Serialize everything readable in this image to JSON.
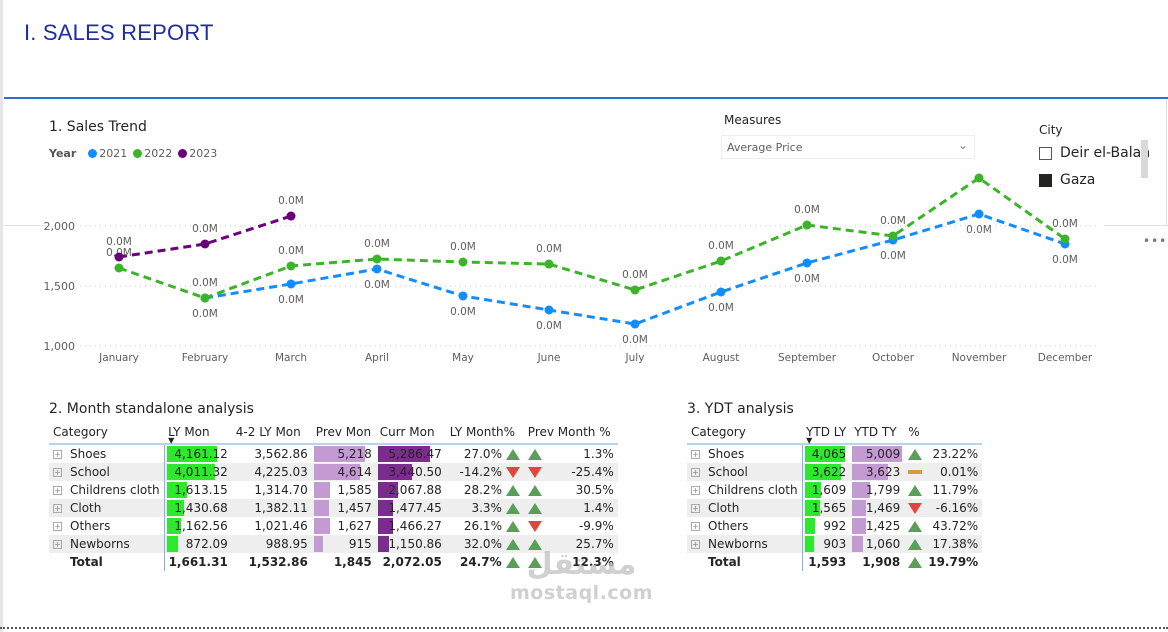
{
  "page": {
    "title": "I. SALES REPORT"
  },
  "sales_trend": {
    "title": "1. Sales Trend",
    "legend_title": "Year",
    "more_icon": "more-options-icon"
  },
  "measures": {
    "label": "Measures",
    "selected": "Average Price"
  },
  "city": {
    "label": "City",
    "options": [
      {
        "label": "Deir el-Balah",
        "checked": false
      },
      {
        "label": "Gaza",
        "checked": true
      }
    ]
  },
  "chart_data": {
    "type": "line",
    "title": "1. Sales Trend",
    "xlabel": "",
    "ylabel": "",
    "x": [
      "January",
      "February",
      "March",
      "April",
      "May",
      "June",
      "July",
      "August",
      "September",
      "October",
      "November",
      "December"
    ],
    "yticks": [
      "1,000",
      "1,500",
      "2,000"
    ],
    "ytick_values": [
      1000,
      1500,
      2000
    ],
    "ylim": [
      1000,
      2000
    ],
    "grid": true,
    "legend_position": "top-left",
    "data_label": "0.0M",
    "series": [
      {
        "name": "2021",
        "color": "#118dff",
        "values": [
          null,
          1400,
          1517,
          1642,
          1417,
          1300,
          1183,
          1450,
          1692,
          1883,
          2100,
          1850
        ]
      },
      {
        "name": "2022",
        "color": "#3bb42a",
        "values": [
          1650,
          1400,
          1667,
          1725,
          1700,
          1683,
          1467,
          1708,
          2008,
          1917,
          2400,
          1892
        ]
      },
      {
        "name": "2023",
        "color": "#6b007b",
        "values": [
          1742,
          1850,
          2083,
          null,
          null,
          null,
          null,
          null,
          null,
          null,
          null,
          null
        ]
      }
    ]
  },
  "month_table": {
    "title": "2. Month standalone analysis",
    "headers": [
      "Category",
      "LY Mon",
      "4-2 LY Mon",
      "Prev Mon",
      "Curr Mon",
      "LY Month%",
      "Prev Month %"
    ],
    "rows": [
      {
        "category": "Shoes",
        "ly_mon": "4,161.12",
        "ly42": "3,562.86",
        "prev_mon": "5,218",
        "curr_mon": "5,286.47",
        "ly_pct": "27.0%",
        "ly_dir": "up",
        "prev_dir": "up",
        "prev_pct": "1.3%",
        "ly_frac": 1.0,
        "prev_frac": 0.99,
        "curr_frac": 1.0
      },
      {
        "category": "School",
        "ly_mon": "4,011.32",
        "ly42": "4,225.03",
        "prev_mon": "4,614",
        "curr_mon": "3,440.50",
        "ly_pct": "-14.2%",
        "ly_dir": "down",
        "prev_dir": "down",
        "prev_pct": "-25.4%",
        "ly_frac": 0.96,
        "prev_frac": 0.88,
        "curr_frac": 0.65
      },
      {
        "category": "Childrens cloth",
        "ly_mon": "1,613.15",
        "ly42": "1,314.70",
        "prev_mon": "1,585",
        "curr_mon": "2,067.88",
        "ly_pct": "28.2%",
        "ly_dir": "up",
        "prev_dir": "up",
        "prev_pct": "30.5%",
        "ly_frac": 0.39,
        "prev_frac": 0.3,
        "curr_frac": 0.39
      },
      {
        "category": "Cloth",
        "ly_mon": "1,430.68",
        "ly42": "1,382.11",
        "prev_mon": "1,457",
        "curr_mon": "1,477.45",
        "ly_pct": "3.3%",
        "ly_dir": "up",
        "prev_dir": "up",
        "prev_pct": "1.4%",
        "ly_frac": 0.34,
        "prev_frac": 0.28,
        "curr_frac": 0.28
      },
      {
        "category": "Others",
        "ly_mon": "1,162.56",
        "ly42": "1,021.46",
        "prev_mon": "1,627",
        "curr_mon": "1,466.27",
        "ly_pct": "26.1%",
        "ly_dir": "up",
        "prev_dir": "down",
        "prev_pct": "-9.9%",
        "ly_frac": 0.28,
        "prev_frac": 0.31,
        "curr_frac": 0.28
      },
      {
        "category": "Newborns",
        "ly_mon": "872.09",
        "ly42": "988.95",
        "prev_mon": "915",
        "curr_mon": "1,150.86",
        "ly_pct": "32.0%",
        "ly_dir": "up",
        "prev_dir": "up",
        "prev_pct": "25.7%",
        "ly_frac": 0.21,
        "prev_frac": 0.18,
        "curr_frac": 0.22
      }
    ],
    "total": {
      "category": "Total",
      "ly_mon": "1,661.31",
      "ly42": "1,532.86",
      "prev_mon": "1,845",
      "curr_mon": "2,072.05",
      "ly_pct": "24.7%",
      "ly_dir": "up",
      "prev_dir": "up",
      "prev_pct": "12.3%"
    }
  },
  "ytd_table": {
    "title": "3. YDT analysis",
    "headers": [
      "Category",
      "YTD LY",
      "YTD TY",
      "%"
    ],
    "rows": [
      {
        "category": "Shoes",
        "ytd_ly": "4,065",
        "ytd_ty": "5,009",
        "dir": "up",
        "pct": "23.22%",
        "ly_frac": 1.0,
        "ty_frac": 1.0
      },
      {
        "category": "School",
        "ytd_ly": "3,622",
        "ytd_ty": "3,623",
        "dir": "flat",
        "pct": "0.01%",
        "ly_frac": 0.89,
        "ty_frac": 0.72
      },
      {
        "category": "Childrens cloth",
        "ytd_ly": "1,609",
        "ytd_ty": "1,799",
        "dir": "up",
        "pct": "11.79%",
        "ly_frac": 0.4,
        "ty_frac": 0.36
      },
      {
        "category": "Cloth",
        "ytd_ly": "1,565",
        "ytd_ty": "1,469",
        "dir": "down",
        "pct": "-6.16%",
        "ly_frac": 0.38,
        "ty_frac": 0.29
      },
      {
        "category": "Others",
        "ytd_ly": "992",
        "ytd_ty": "1,425",
        "dir": "up",
        "pct": "43.72%",
        "ly_frac": 0.24,
        "ty_frac": 0.28
      },
      {
        "category": "Newborns",
        "ytd_ly": "903",
        "ytd_ty": "1,060",
        "dir": "up",
        "pct": "17.38%",
        "ly_frac": 0.22,
        "ty_frac": 0.21
      }
    ],
    "total": {
      "category": "Total",
      "ytd_ly": "1,593",
      "ytd_ty": "1,908",
      "dir": "up",
      "pct": "19.79%"
    }
  },
  "colors": {
    "title_blue": "#1f2e9c",
    "ly_bar": "#2ee82e",
    "prev_bar": "#c39ad1",
    "curr_bar": "#7b2d8e",
    "up": "#5a9e5a",
    "down": "#e0463b",
    "flat": "#d89a3e"
  },
  "watermark": {
    "arabic": "مستقل",
    "latin": "mostaql.com"
  }
}
